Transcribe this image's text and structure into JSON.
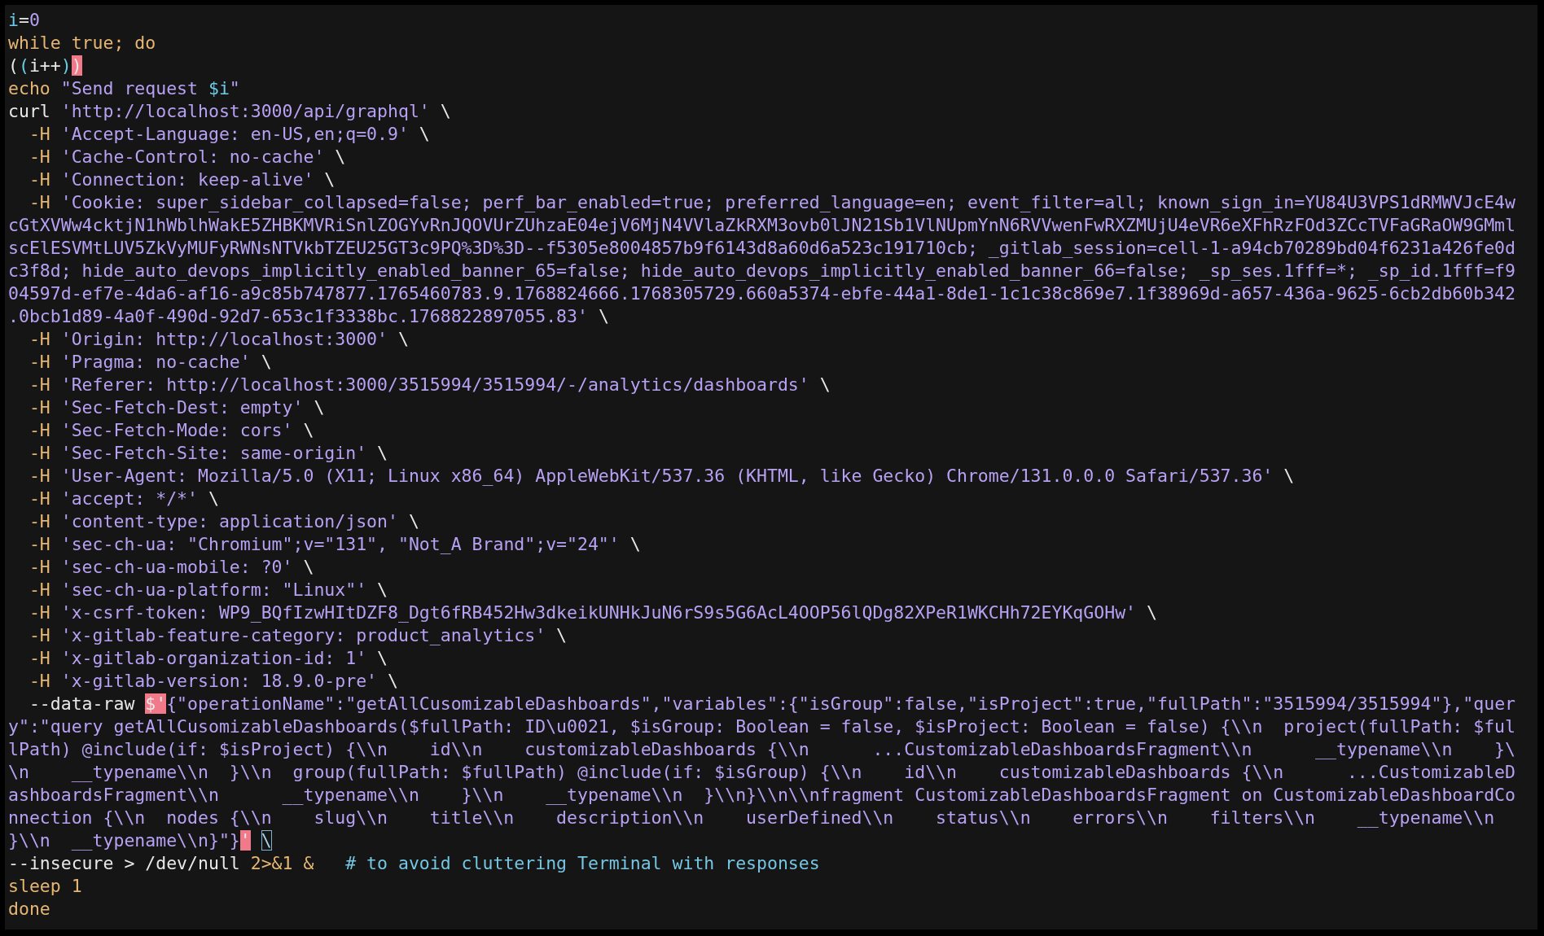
{
  "terminal": {
    "lines": [
      [
        {
          "kind": "variable",
          "text": "i"
        },
        {
          "kind": "text",
          "text": "="
        },
        {
          "kind": "number",
          "text": "0"
        }
      ],
      [
        {
          "kind": "keyword",
          "text": "while true; do"
        }
      ],
      [
        {
          "kind": "text",
          "text": "("
        },
        {
          "kind": "variable",
          "text": "("
        },
        {
          "kind": "text",
          "text": "i++"
        },
        {
          "kind": "variable",
          "text": ")"
        },
        {
          "kind": "match",
          "text": ")"
        }
      ],
      [
        {
          "kind": "keyword",
          "text": "echo "
        },
        {
          "kind": "string",
          "text": "\"Send request "
        },
        {
          "kind": "variable",
          "text": "$i"
        },
        {
          "kind": "string",
          "text": "\""
        }
      ],
      [
        {
          "kind": "text",
          "text": "curl "
        },
        {
          "kind": "string",
          "text": "'http://localhost:3000/api/graphql'"
        },
        {
          "kind": "text",
          "text": " \\"
        }
      ],
      [
        {
          "kind": "keyword",
          "text": "  -H"
        },
        {
          "kind": "string",
          "text": " 'Accept-Language: en-US,en;q=0.9'"
        },
        {
          "kind": "text",
          "text": " \\"
        }
      ],
      [
        {
          "kind": "keyword",
          "text": "  -H"
        },
        {
          "kind": "string",
          "text": " 'Cache-Control: no-cache'"
        },
        {
          "kind": "text",
          "text": " \\"
        }
      ],
      [
        {
          "kind": "keyword",
          "text": "  -H"
        },
        {
          "kind": "string",
          "text": " 'Connection: keep-alive'"
        },
        {
          "kind": "text",
          "text": " \\"
        }
      ],
      [
        {
          "kind": "keyword",
          "text": "  -H"
        },
        {
          "kind": "string",
          "text": " 'Cookie: super_sidebar_collapsed=false; perf_bar_enabled=true; preferred_language=en; event_filter=all; known_sign_in=YU84U3VPS1dRMWVJcE4w"
        }
      ],
      [
        {
          "kind": "string",
          "text": "cGtXVWw4cktjN1hWblhWakE5ZHBKMVRiSnlZOGYvRnJQOVUrZUhzaE04ejV6MjN4VVlaZkRXM3ovb0lJN21Sb1VlNUpmYnN6RVVwenFwRXZMUjU4eVR6eXFhRzFOd3ZCcTVFaGRaOW9GMml"
        }
      ],
      [
        {
          "kind": "string",
          "text": "scElESVMtLUV5ZkVyMUFyRWNsNTVkbTZEU25GT3c9PQ%3D%3D--f5305e8004857b9f6143d8a60d6a523c191710cb; _gitlab_session=cell-1-a94cb70289bd04f6231a426fe0d"
        }
      ],
      [
        {
          "kind": "string",
          "text": "c3f8d; hide_auto_devops_implicitly_enabled_banner_65=false; hide_auto_devops_implicitly_enabled_banner_66=false; _sp_ses.1fff=*; _sp_id.1fff=f9"
        }
      ],
      [
        {
          "kind": "string",
          "text": "04597d-ef7e-4da6-af16-a9c85b747877.1765460783.9.1768824666.1768305729.660a5374-ebfe-44a1-8de1-1c1c38c869e7.1f38969d-a657-436a-9625-6cb2db60b342"
        }
      ],
      [
        {
          "kind": "string",
          "text": ".0bcb1d89-4a0f-490d-92d7-653c1f3338bc.1768822897055.83'"
        },
        {
          "kind": "text",
          "text": " \\"
        }
      ],
      [
        {
          "kind": "keyword",
          "text": "  -H"
        },
        {
          "kind": "string",
          "text": " 'Origin: http://localhost:3000'"
        },
        {
          "kind": "text",
          "text": " \\"
        }
      ],
      [
        {
          "kind": "keyword",
          "text": "  -H"
        },
        {
          "kind": "string",
          "text": " 'Pragma: no-cache'"
        },
        {
          "kind": "text",
          "text": " \\"
        }
      ],
      [
        {
          "kind": "keyword",
          "text": "  -H"
        },
        {
          "kind": "string",
          "text": " 'Referer: http://localhost:3000/3515994/3515994/-/analytics/dashboards'"
        },
        {
          "kind": "text",
          "text": " \\"
        }
      ],
      [
        {
          "kind": "keyword",
          "text": "  -H"
        },
        {
          "kind": "string",
          "text": " 'Sec-Fetch-Dest: empty'"
        },
        {
          "kind": "text",
          "text": " \\"
        }
      ],
      [
        {
          "kind": "keyword",
          "text": "  -H"
        },
        {
          "kind": "string",
          "text": " 'Sec-Fetch-Mode: cors'"
        },
        {
          "kind": "text",
          "text": " \\"
        }
      ],
      [
        {
          "kind": "keyword",
          "text": "  -H"
        },
        {
          "kind": "string",
          "text": " 'Sec-Fetch-Site: same-origin'"
        },
        {
          "kind": "text",
          "text": " \\"
        }
      ],
      [
        {
          "kind": "keyword",
          "text": "  -H"
        },
        {
          "kind": "string",
          "text": " 'User-Agent: Mozilla/5.0 (X11; Linux x86_64) AppleWebKit/537.36 (KHTML, like Gecko) Chrome/131.0.0.0 Safari/537.36'"
        },
        {
          "kind": "text",
          "text": " \\"
        }
      ],
      [
        {
          "kind": "keyword",
          "text": "  -H"
        },
        {
          "kind": "string",
          "text": " 'accept: */*'"
        },
        {
          "kind": "text",
          "text": " \\"
        }
      ],
      [
        {
          "kind": "keyword",
          "text": "  -H"
        },
        {
          "kind": "string",
          "text": " 'content-type: application/json'"
        },
        {
          "kind": "text",
          "text": " \\"
        }
      ],
      [
        {
          "kind": "keyword",
          "text": "  -H"
        },
        {
          "kind": "string",
          "text": " 'sec-ch-ua: \"Chromium\";v=\"131\", \"Not_A Brand\";v=\"24\"'"
        },
        {
          "kind": "text",
          "text": " \\"
        }
      ],
      [
        {
          "kind": "keyword",
          "text": "  -H"
        },
        {
          "kind": "string",
          "text": " 'sec-ch-ua-mobile: ?0'"
        },
        {
          "kind": "text",
          "text": " \\"
        }
      ],
      [
        {
          "kind": "keyword",
          "text": "  -H"
        },
        {
          "kind": "string",
          "text": " 'sec-ch-ua-platform: \"Linux\"'"
        },
        {
          "kind": "text",
          "text": " \\"
        }
      ],
      [
        {
          "kind": "keyword",
          "text": "  -H"
        },
        {
          "kind": "string",
          "text": " 'x-csrf-token: WP9_BQfIzwHItDZF8_Dgt6fRB452Hw3dkeikUNHkJuN6rS9s5G6AcL4OOP56lQDg82XPeR1WKCHh72EYKqGOHw'"
        },
        {
          "kind": "text",
          "text": " \\"
        }
      ],
      [
        {
          "kind": "keyword",
          "text": "  -H"
        },
        {
          "kind": "string",
          "text": " 'x-gitlab-feature-category: product_analytics'"
        },
        {
          "kind": "text",
          "text": " \\"
        }
      ],
      [
        {
          "kind": "keyword",
          "text": "  -H"
        },
        {
          "kind": "string",
          "text": " 'x-gitlab-organization-id: 1'"
        },
        {
          "kind": "text",
          "text": " \\"
        }
      ],
      [
        {
          "kind": "keyword",
          "text": "  -H"
        },
        {
          "kind": "string",
          "text": " 'x-gitlab-version: 18.9.0-pre'"
        },
        {
          "kind": "text",
          "text": " \\"
        }
      ],
      [
        {
          "kind": "text",
          "text": "  --data-raw "
        },
        {
          "kind": "match",
          "text": "$'"
        },
        {
          "kind": "string",
          "text": "{\"operationName\":\"getAllCusomizableDashboards\",\"variables\":{\"isGroup\":false,\"isProject\":true,\"fullPath\":\"3515994/3515994\"},\"quer"
        }
      ],
      [
        {
          "kind": "string",
          "text": "y\":\"query getAllCusomizableDashboards($fullPath: ID\\u0021, $isGroup: Boolean = false, $isProject: Boolean = false) {\\\\n  project(fullPath: $ful"
        }
      ],
      [
        {
          "kind": "string",
          "text": "lPath) @include(if: $isProject) {\\\\n    id\\\\n    customizableDashboards {\\\\n      ...CustomizableDashboardsFragment\\\\n      __typename\\\\n    }\\"
        }
      ],
      [
        {
          "kind": "string",
          "text": "\\n    __typename\\\\n  }\\\\n  group(fullPath: $fullPath) @include(if: $isGroup) {\\\\n    id\\\\n    customizableDashboards {\\\\n      ...CustomizableD"
        }
      ],
      [
        {
          "kind": "string",
          "text": "ashboardsFragment\\\\n      __typename\\\\n    }\\\\n    __typename\\\\n  }\\\\n}\\\\n\\\\nfragment CustomizableDashboardsFragment on CustomizableDashboardCo"
        }
      ],
      [
        {
          "kind": "string",
          "text": "nnection {\\\\n  nodes {\\\\n    slug\\\\n    title\\\\n    description\\\\n    userDefined\\\\n    status\\\\n    errors\\\\n    filters\\\\n    __typename\\\\n"
        }
      ],
      [
        {
          "kind": "string",
          "text": "}\\\\n  __typename\\\\n}\"}"
        },
        {
          "kind": "match",
          "text": "'"
        },
        {
          "kind": "cursor",
          "text": "\\"
        }
      ],
      [
        {
          "kind": "text",
          "text": "--insecure > /dev/null "
        },
        {
          "kind": "keyword",
          "text": "2>&1 &"
        },
        {
          "kind": "comment",
          "text": "   # to avoid cluttering Terminal with responses"
        }
      ],
      [
        {
          "kind": "keyword",
          "text": "sleep 1"
        }
      ],
      [
        {
          "kind": "keyword",
          "text": "done"
        }
      ]
    ]
  }
}
